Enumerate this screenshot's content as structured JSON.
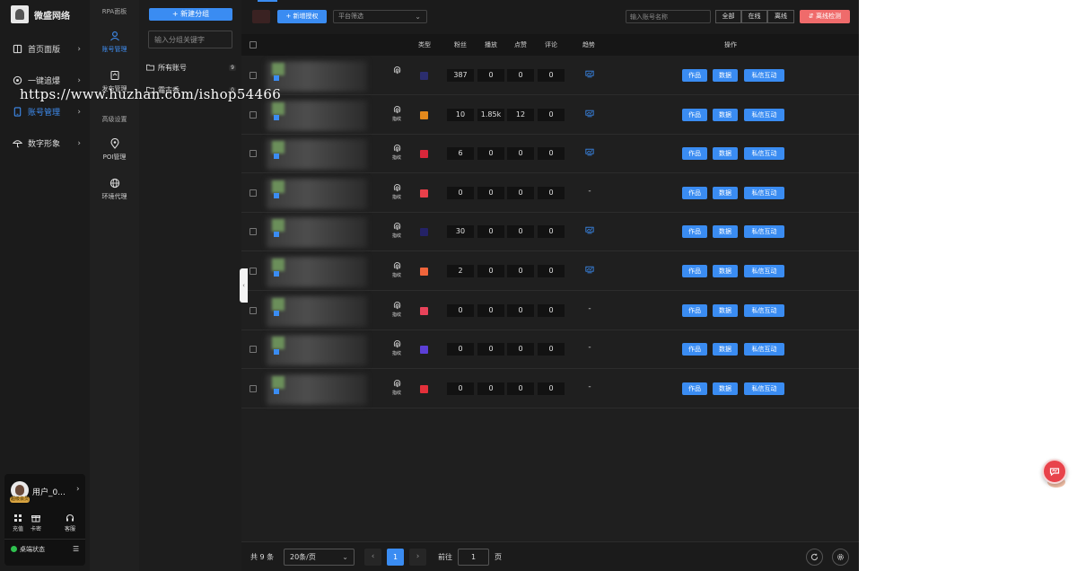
{
  "brand": {
    "name": "微盛网络"
  },
  "watermark": "https://www.huzhan.com/ishop54466",
  "nav": [
    {
      "label": "首页面版",
      "chev": "›"
    },
    {
      "label": "一键追爆",
      "chev": "›"
    },
    {
      "label": "账号管理",
      "chev": "›"
    },
    {
      "label": "数字形象",
      "chev": "›"
    }
  ],
  "subnav": {
    "section1": "RPA面板",
    "account_mgmt": "账号管理",
    "publish_mgmt": "发布管理",
    "section2": "高级设置",
    "poi_mgmt": "POI管理",
    "proxy": "环境代理"
  },
  "groups": {
    "new_button": "+ 新建分组",
    "search_placeholder": "输入分组关键字",
    "items": [
      {
        "label": "所有账号",
        "count": "9"
      },
      {
        "label": "霜古香",
        "count": "0"
      }
    ]
  },
  "toolbar": {
    "new_auth": "+ 新增授权",
    "platform_filter": "平台筛选",
    "dropdown_glyph": "⌄",
    "search_placeholder": "输入账号名称",
    "filter_all": "全部",
    "filter_online": "在线",
    "filter_offline": "离线",
    "offline_check": "离线检测"
  },
  "table": {
    "headers": {
      "type": "类型",
      "fans": "粉丝",
      "plays": "播放",
      "likes": "点赞",
      "comments": "评论",
      "trend": "趋势",
      "actions": "操作"
    },
    "fingerprint_label": "指纹",
    "action_works": "作品",
    "action_data": "数据",
    "action_dm": "私信互动",
    "blurred_fragments": [
      "s",
      "1#",
      "江苏省徐州市",
      "117.87.16",
      "117.8",
      "6-04-",
      "江苏省徐州市"
    ],
    "rows": [
      {
        "fans": "387",
        "plays": "0",
        "likes": "0",
        "comments": "0",
        "trend": "chart",
        "platform_color": "#2b2d6e",
        "show_fp_label": false
      },
      {
        "fans": "10",
        "plays": "1.85k",
        "likes": "12",
        "comments": "0",
        "trend": "chart",
        "platform_color": "#e58a1c",
        "show_fp_label": true
      },
      {
        "fans": "6",
        "plays": "0",
        "likes": "0",
        "comments": "0",
        "trend": "chart",
        "platform_color": "#d8273a",
        "show_fp_label": true
      },
      {
        "fans": "0",
        "plays": "0",
        "likes": "0",
        "comments": "0",
        "trend": "-",
        "platform_color": "#e8404a",
        "show_fp_label": true
      },
      {
        "fans": "30",
        "plays": "0",
        "likes": "0",
        "comments": "0",
        "trend": "chart",
        "platform_color": "#242266",
        "show_fp_label": true
      },
      {
        "fans": "2",
        "plays": "0",
        "likes": "0",
        "comments": "0",
        "trend": "chart",
        "platform_color": "#f0653b",
        "show_fp_label": true
      },
      {
        "fans": "0",
        "plays": "0",
        "likes": "0",
        "comments": "0",
        "trend": "-",
        "platform_color": "#e8435a",
        "show_fp_label": true
      },
      {
        "fans": "0",
        "plays": "0",
        "likes": "0",
        "comments": "0",
        "trend": "-",
        "platform_color": "#5b3fd6",
        "show_fp_label": true
      },
      {
        "fans": "0",
        "plays": "0",
        "likes": "0",
        "comments": "0",
        "trend": "-",
        "platform_color": "#e3303a",
        "show_fp_label": true
      }
    ]
  },
  "pager": {
    "total": "共 9 条",
    "page_size": "20条/页",
    "current": "1",
    "goto": "前往",
    "goto_value": "1",
    "page_unit": "页",
    "prev": "‹",
    "next": "›"
  },
  "user": {
    "name": "用户_0...",
    "vip": "超级会员",
    "recharge": "充值",
    "card": "卡密",
    "service": "客服",
    "status": "桌端状态"
  },
  "colors": {
    "accent": "#3a8cf2",
    "danger": "#ef6b6b",
    "online": "#2fc14f"
  }
}
